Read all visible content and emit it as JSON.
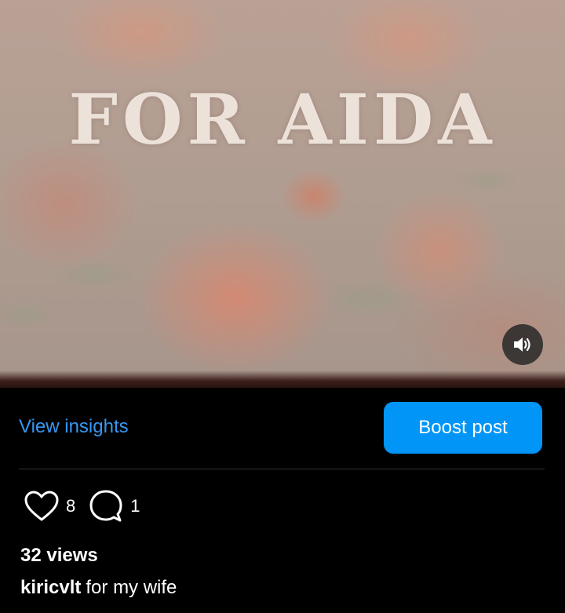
{
  "media": {
    "title_text": "FOR AIDA",
    "sound_icon": "speaker-icon"
  },
  "actions": {
    "view_insights_label": "View insights",
    "boost_label": "Boost post",
    "accent_color": "#0095f6",
    "link_color": "#3797f0"
  },
  "stats": {
    "likes": "8",
    "comments": "1",
    "like_icon": "heart-icon",
    "comment_icon": "comment-icon"
  },
  "post": {
    "views": "32 views",
    "username": "kiricvlt",
    "caption": "for my wife"
  }
}
